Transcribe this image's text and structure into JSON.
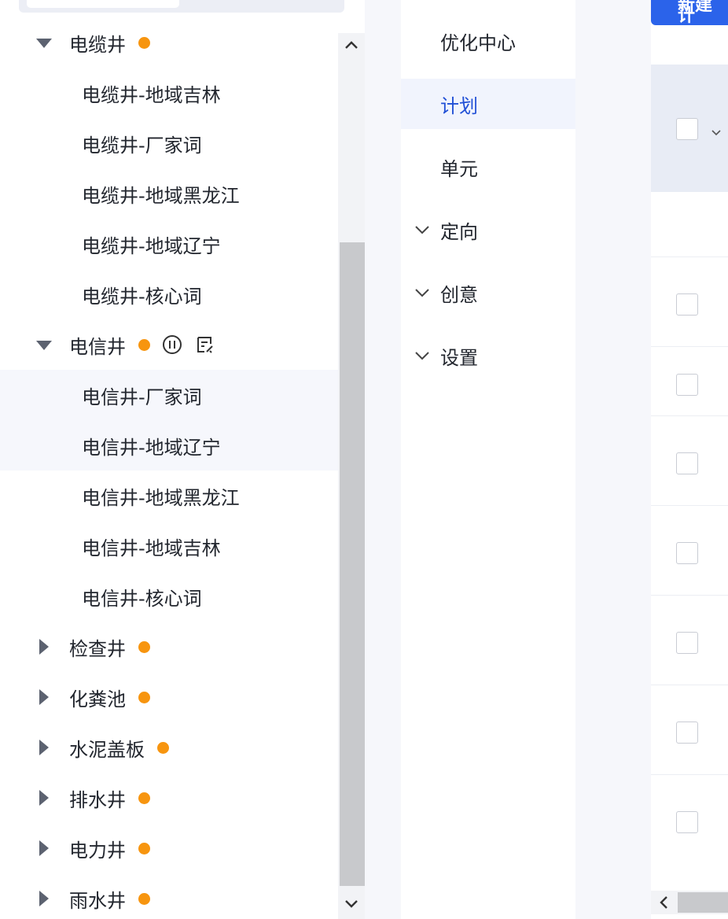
{
  "tree": {
    "nodes": [
      {
        "kind": "group",
        "label": "电缆井",
        "expanded": true,
        "status": "orange-dot"
      },
      {
        "kind": "leaf",
        "label": "电缆井-地域吉林"
      },
      {
        "kind": "leaf",
        "label": "电缆井-厂家词"
      },
      {
        "kind": "leaf",
        "label": "电缆井-地域黑龙江"
      },
      {
        "kind": "leaf",
        "label": "电缆井-地域辽宁"
      },
      {
        "kind": "leaf",
        "label": "电缆井-核心词"
      },
      {
        "kind": "group",
        "label": "电信井",
        "expanded": true,
        "status": "orange-dot",
        "actions": [
          "pause-icon",
          "edit-note-icon"
        ]
      },
      {
        "kind": "leaf",
        "label": "电信井-厂家词",
        "highlight": true
      },
      {
        "kind": "leaf",
        "label": "电信井-地域辽宁",
        "highlight": true
      },
      {
        "kind": "leaf",
        "label": "电信井-地域黑龙江"
      },
      {
        "kind": "leaf",
        "label": "电信井-地域吉林"
      },
      {
        "kind": "leaf",
        "label": "电信井-核心词"
      },
      {
        "kind": "group",
        "label": "检查井",
        "expanded": false,
        "status": "orange-dot"
      },
      {
        "kind": "group",
        "label": "化粪池",
        "expanded": false,
        "status": "orange-dot"
      },
      {
        "kind": "group",
        "label": "水泥盖板",
        "expanded": false,
        "status": "orange-dot"
      },
      {
        "kind": "group",
        "label": "排水井",
        "expanded": false,
        "status": "orange-dot"
      },
      {
        "kind": "group",
        "label": "电力井",
        "expanded": false,
        "status": "orange-dot"
      },
      {
        "kind": "group",
        "label": "雨水井",
        "expanded": false,
        "status": "orange-dot"
      }
    ]
  },
  "nav": {
    "items": [
      {
        "label": "优化中心",
        "active": false,
        "collapsible": false
      },
      {
        "label": "计划",
        "active": true,
        "collapsible": false
      },
      {
        "label": "单元",
        "active": false,
        "collapsible": false
      },
      {
        "label": "定向",
        "active": false,
        "collapsible": true
      },
      {
        "label": "创意",
        "active": false,
        "collapsible": true
      },
      {
        "label": "设置",
        "active": false,
        "collapsible": true
      }
    ]
  },
  "toolbar": {
    "new_button_label": "新建计"
  },
  "table": {
    "row_count": 7
  },
  "colors": {
    "accent": "#2b63ea",
    "active_text": "#2150d6",
    "status_dot": "#f7950f"
  }
}
